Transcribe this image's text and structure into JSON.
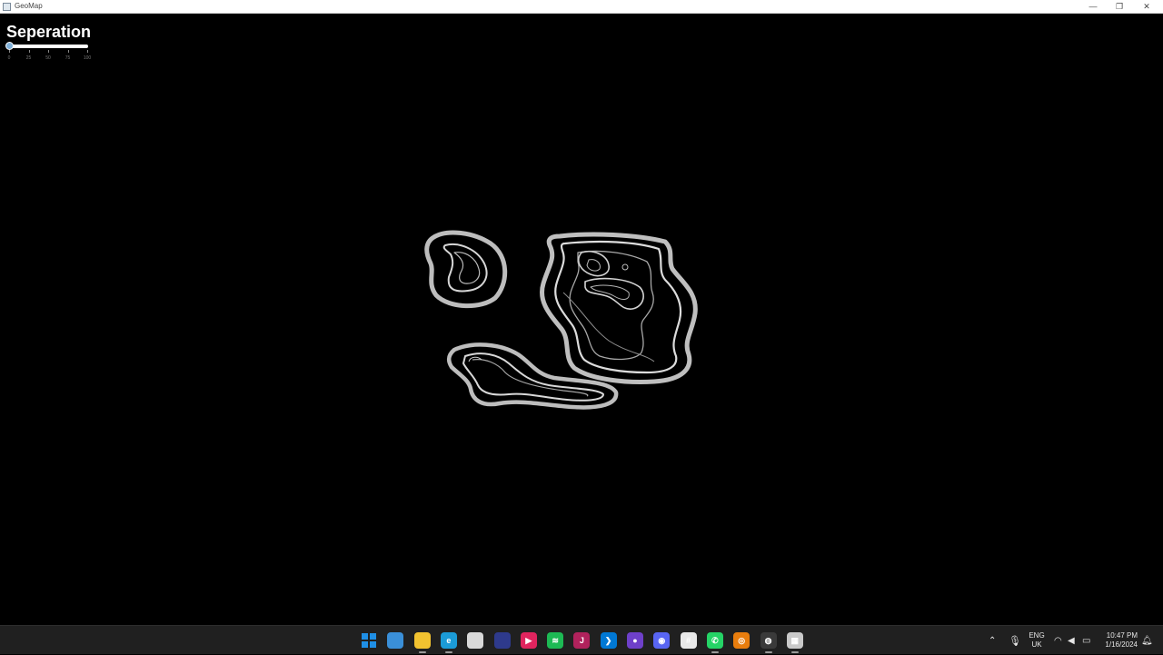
{
  "window": {
    "title": "GeoMap",
    "minimize": "—",
    "restore": "❐",
    "close": "✕"
  },
  "slider": {
    "title": "Seperation",
    "value_percent": 0,
    "tick_labels": [
      "0",
      "25",
      "50",
      "75",
      "100"
    ]
  },
  "taskbar": {
    "apps": [
      {
        "name": "start-icon",
        "glyph": "",
        "color": "#1f8fe6"
      },
      {
        "name": "widgets-icon",
        "glyph": "",
        "color": "#3a8fd8"
      },
      {
        "name": "file-explorer-icon",
        "glyph": "",
        "color": "#f2c230"
      },
      {
        "name": "edge-icon",
        "glyph": "e",
        "color": "#1b9bd7"
      },
      {
        "name": "store-icon",
        "glyph": "",
        "color": "#d9d9d9"
      },
      {
        "name": "app-icon-flame",
        "glyph": "",
        "color": "#2e3a8c"
      },
      {
        "name": "media-player-icon",
        "glyph": "▶",
        "color": "#e0245e"
      },
      {
        "name": "spotify-icon",
        "glyph": "≋",
        "color": "#1db954"
      },
      {
        "name": "jetbrains-icon",
        "glyph": "J",
        "color": "#b0225c"
      },
      {
        "name": "vscode-icon",
        "glyph": "❯",
        "color": "#0078d4"
      },
      {
        "name": "github-icon",
        "glyph": "●",
        "color": "#6e40c9"
      },
      {
        "name": "discord-icon",
        "glyph": "◉",
        "color": "#5865f2"
      },
      {
        "name": "slack-icon",
        "glyph": "#",
        "color": "#e8e8e8"
      },
      {
        "name": "whatsapp-icon",
        "glyph": "✆",
        "color": "#25d366"
      },
      {
        "name": "blender-icon",
        "glyph": "◎",
        "color": "#e87d0d"
      },
      {
        "name": "obs-icon",
        "glyph": "◍",
        "color": "#3a3a3a"
      },
      {
        "name": "geomap-app-icon",
        "glyph": "▦",
        "color": "#c9c9c9"
      }
    ],
    "language": {
      "line1": "ENG",
      "line2": "UK"
    },
    "time": "10:47 PM",
    "date": "1/16/2024"
  }
}
